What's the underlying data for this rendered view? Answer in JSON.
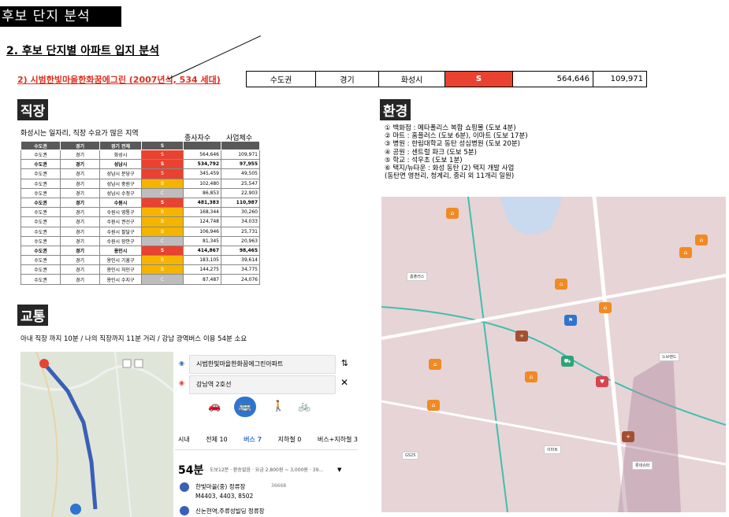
{
  "page": {
    "title": "후보 단지 분석",
    "section_heading": "2. 후보 단지별 아파트 입지 분석",
    "complex_title": "2) 시범한빛마을한화꿈에그린 (2007년식, 534 세대)"
  },
  "summary": {
    "cells": [
      "수도권",
      "경기",
      "화성시",
      "S",
      "564,646",
      "109,971"
    ]
  },
  "job": {
    "label": "직장",
    "note": "화성시는 일자리, 직장 수요가 많은 지역",
    "col_h1": "종사자수",
    "col_h2": "사업체수",
    "headers": [
      "수도권",
      "경기",
      "경기 전체",
      "S",
      "",
      ""
    ],
    "rows": [
      {
        "c": [
          "수도권",
          "경기",
          "화성시",
          "S",
          "564,646",
          "109,971"
        ],
        "bold": false
      },
      {
        "c": [
          "수도권",
          "경기",
          "성남시",
          "S",
          "534,792",
          "97,955"
        ],
        "bold": true
      },
      {
        "c": [
          "수도권",
          "경기",
          "성남시 분당구",
          "S",
          "345,459",
          "49,505"
        ],
        "bold": false
      },
      {
        "c": [
          "수도권",
          "경기",
          "성남시 중원구",
          "B",
          "102,480",
          "25,547"
        ],
        "bold": false
      },
      {
        "c": [
          "수도권",
          "경기",
          "성남시 수정구",
          "C",
          "86,853",
          "22,903"
        ],
        "bold": false
      },
      {
        "c": [
          "수도권",
          "경기",
          "수원시",
          "S",
          "481,383",
          "110,987"
        ],
        "bold": true
      },
      {
        "c": [
          "수도권",
          "경기",
          "수원시 영통구",
          "B",
          "168,344",
          "30,260"
        ],
        "bold": false
      },
      {
        "c": [
          "수도권",
          "경기",
          "수원시 권선구",
          "B",
          "124,748",
          "34,033"
        ],
        "bold": false
      },
      {
        "c": [
          "수도권",
          "경기",
          "수원시 팔달구",
          "B",
          "106,946",
          "25,731"
        ],
        "bold": false
      },
      {
        "c": [
          "수도권",
          "경기",
          "수원시 장안구",
          "C",
          "81,345",
          "20,963"
        ],
        "bold": false
      },
      {
        "c": [
          "수도권",
          "경기",
          "용인시",
          "S",
          "414,867",
          "98,465"
        ],
        "bold": true
      },
      {
        "c": [
          "수도권",
          "경기",
          "용인시 기흥구",
          "B",
          "183,105",
          "39,614"
        ],
        "bold": false
      },
      {
        "c": [
          "수도권",
          "경기",
          "용인시 처인구",
          "B",
          "144,275",
          "34,775"
        ],
        "bold": false
      },
      {
        "c": [
          "수도권",
          "경기",
          "용인시 수지구",
          "C",
          "87,487",
          "24,076"
        ],
        "bold": false
      }
    ]
  },
  "env": {
    "label": "환경",
    "items": [
      "① 백화점 : 메타폴리스 복합 쇼핑몰 (도보 4분)",
      "② 마트 : 홈플러스 (도보 6분), 이마트 (도보 17분)",
      "③ 병원 : 한림대학교 동탄 성심병원 (도보 20분)",
      "④ 공원 : 센트럴 파크 (도보 5분)",
      "⑤ 학교 : 석우초 (도보 1분)",
      "⑥ 택지/뉴타운 : 화성 동탄 (2) 택지 개발 사업",
      "  (동탄면 영천리, 청계리, 중리 외 11개리 일원)"
    ]
  },
  "traffic": {
    "label": "교통",
    "note": "아내 직장 까지 10분 / 나의 직장까지 11분 거리 / 강남 광역버스 이용 54분 소요",
    "origin": "시범한빛마을한화꿈에그린아파트",
    "destination": "강남역 2호선",
    "tabs": [
      "시내",
      "전체 10",
      "버스 7",
      "지하철 0",
      "버스+지하철 3"
    ],
    "duration": "54분",
    "duration_detail": "도보12분 · 환승없음 · 요금 2,800원 ~ 3,000원 · 39...",
    "stop1": "한빛마을(중) 정류장",
    "stop1_code": "36668",
    "routes": "M4403, 4403, 8502",
    "stop2": "신논현역,주류성빌딩 정류장"
  },
  "colors": {
    "accent_red": "#e94230",
    "accent_yellow": "#f4b400",
    "label_bg": "#262626"
  }
}
